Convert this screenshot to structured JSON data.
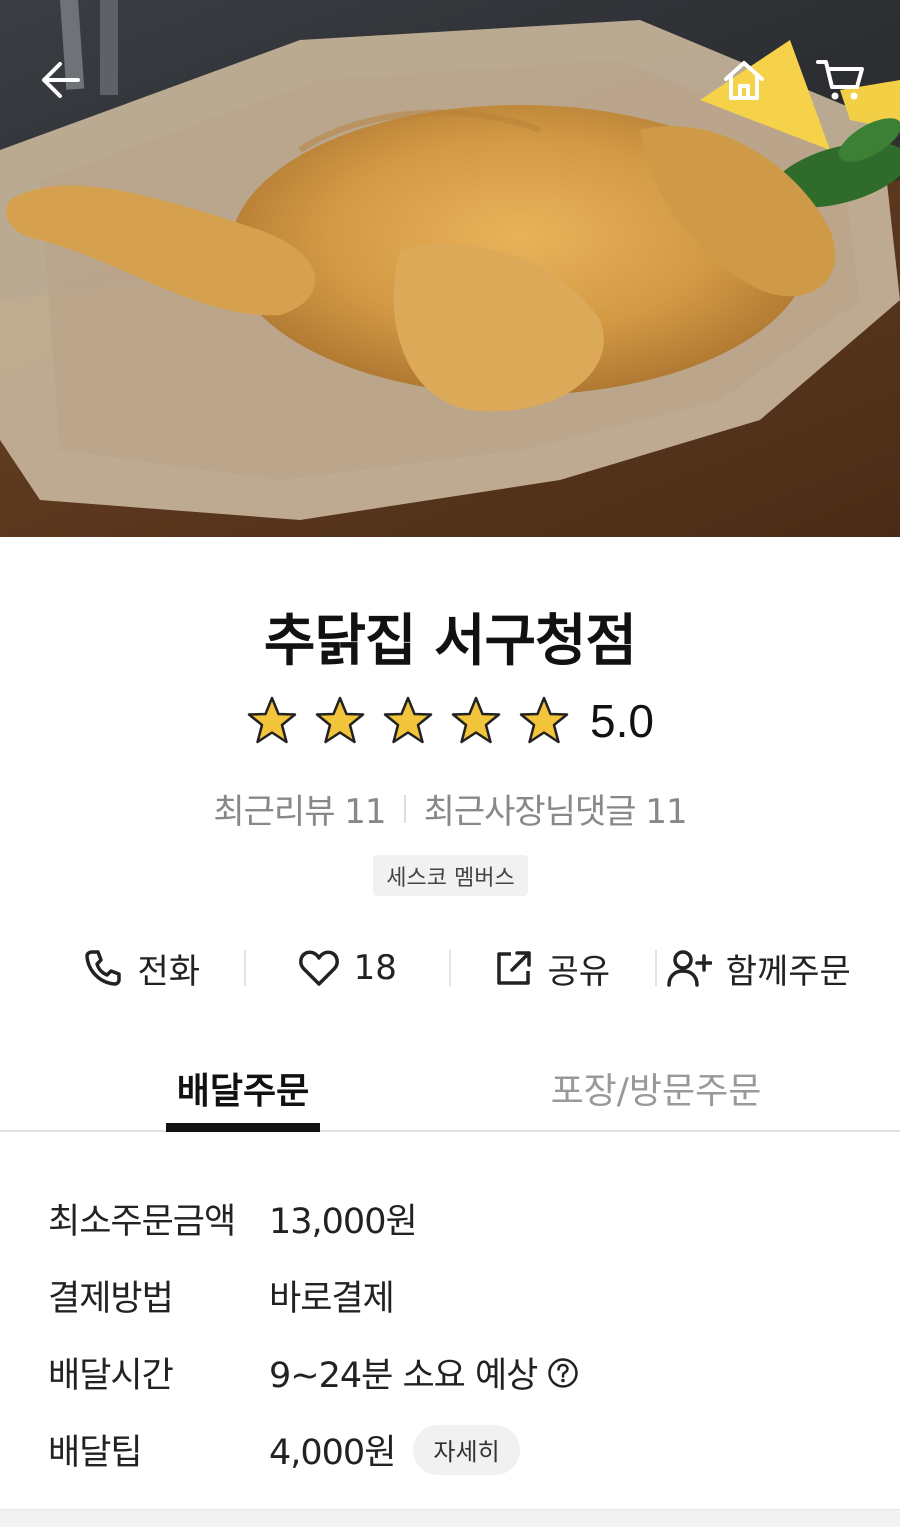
{
  "store": {
    "name": "추닭집 서구청점",
    "rating": "5.0",
    "star_count": 5,
    "recent_reviews_label": "최근리뷰 11",
    "recent_owner_replies_label": "최근사장님댓글 11",
    "member_badge": "세스코 멤버스"
  },
  "actions": {
    "call_label": "전화",
    "like_count": "18",
    "share_label": "공유",
    "group_order_label": "함께주문"
  },
  "tabs": {
    "delivery": "배달주문",
    "pickup": "포장/방문주문"
  },
  "info": {
    "min_order_label": "최소주문금액",
    "min_order_value": "13,000원",
    "payment_label": "결제방법",
    "payment_value": "바로결제",
    "delivery_time_label": "배달시간",
    "delivery_time_value": "9~24분 소요 예상",
    "delivery_tip_label": "배달팁",
    "delivery_tip_value": "4,000원",
    "detail_button": "자세히"
  },
  "icons": {
    "back": "back-arrow-icon",
    "home": "home-icon",
    "cart": "cart-icon",
    "star": "star-icon",
    "phone": "phone-icon",
    "heart": "heart-icon",
    "share": "share-icon",
    "add_user": "add-user-icon",
    "help": "question-circle-icon"
  },
  "colors": {
    "star_fill": "#f2c43c",
    "active_tab": "#111111",
    "inactive_tab": "#999999"
  }
}
